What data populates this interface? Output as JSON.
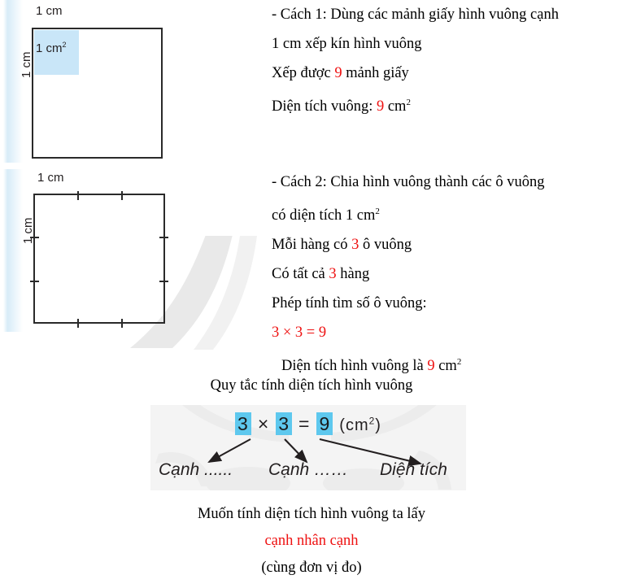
{
  "figures": {
    "figure1": {
      "top_label": "1 cm",
      "side_label": "1 cm",
      "cell_label_text": "1 cm",
      "cell_label_sup": "2",
      "fill_color": "#c9e6f8",
      "border_color": "#2a2a2a"
    },
    "figure2": {
      "top_label": "1 cm",
      "side_label": "1 cm",
      "divisions": 3,
      "border_color": "#2a2a2a"
    }
  },
  "method1": {
    "lines": [
      {
        "parts": [
          {
            "t": "- Cách 1: Dùng các mảnh giấy hình vuông cạnh",
            "c": "black"
          }
        ]
      },
      {
        "parts": [
          {
            "t": "1 cm xếp kín hình vuông",
            "c": "black"
          }
        ]
      },
      {
        "parts": [
          {
            "t": "Xếp được ",
            "c": "black"
          },
          {
            "t": "9",
            "c": "red"
          },
          {
            "t": " mảnh giấy",
            "c": "black"
          }
        ]
      },
      {
        "parts": [
          {
            "t": "Diện tích vuông: ",
            "c": "black"
          },
          {
            "t": "9",
            "c": "red"
          },
          {
            "t": " cm",
            "c": "black"
          },
          {
            "t": "2",
            "c": "black",
            "sup": true
          }
        ]
      }
    ]
  },
  "method2": {
    "lines": [
      {
        "parts": [
          {
            "t": "- Cách 2: Chia hình vuông thành các ô vuông",
            "c": "black"
          }
        ]
      },
      {
        "parts": [
          {
            "t": "có diện tích 1 cm",
            "c": "black"
          },
          {
            "t": "2",
            "c": "black",
            "sup": true
          }
        ]
      },
      {
        "parts": [
          {
            "t": "Mỗi hàng có ",
            "c": "black"
          },
          {
            "t": "3",
            "c": "red"
          },
          {
            "t": " ô vuông",
            "c": "black"
          }
        ]
      },
      {
        "parts": [
          {
            "t": "Có tất cả ",
            "c": "black"
          },
          {
            "t": "3",
            "c": "red"
          },
          {
            "t": " hàng",
            "c": "black"
          }
        ]
      },
      {
        "parts": [
          {
            "t": "Phép tính tìm số ô vuông:",
            "c": "black"
          }
        ]
      },
      {
        "parts": [
          {
            "t": "3 × 3 = 9",
            "c": "red"
          }
        ]
      },
      {
        "indent": true,
        "parts": [
          {
            "t": "Diện tích hình vuông là ",
            "c": "black"
          },
          {
            "t": "9",
            "c": "red"
          },
          {
            "t": " cm",
            "c": "black"
          },
          {
            "t": "2",
            "c": "black",
            "sup": true
          }
        ]
      }
    ]
  },
  "rule": {
    "heading": "Quy tắc tính diện tích hình vuông",
    "formula": {
      "factor1": "3",
      "operator": "×",
      "factor2": "3",
      "equals": "=",
      "product": "9",
      "unit_text": "(cm",
      "unit_sup": "2",
      "unit_close": ")",
      "highlight_color": "#5ec8ee"
    },
    "arrow_labels": [
      "Cạnh ......",
      "Cạnh ……",
      "Diện tích"
    ],
    "statement_line1": "Muốn tính diện tích hình vuông ta lấy",
    "statement_line2": "cạnh nhân cạnh",
    "statement_line3": "(cùng đơn vị đo)",
    "accent_red": "#ee1111"
  }
}
